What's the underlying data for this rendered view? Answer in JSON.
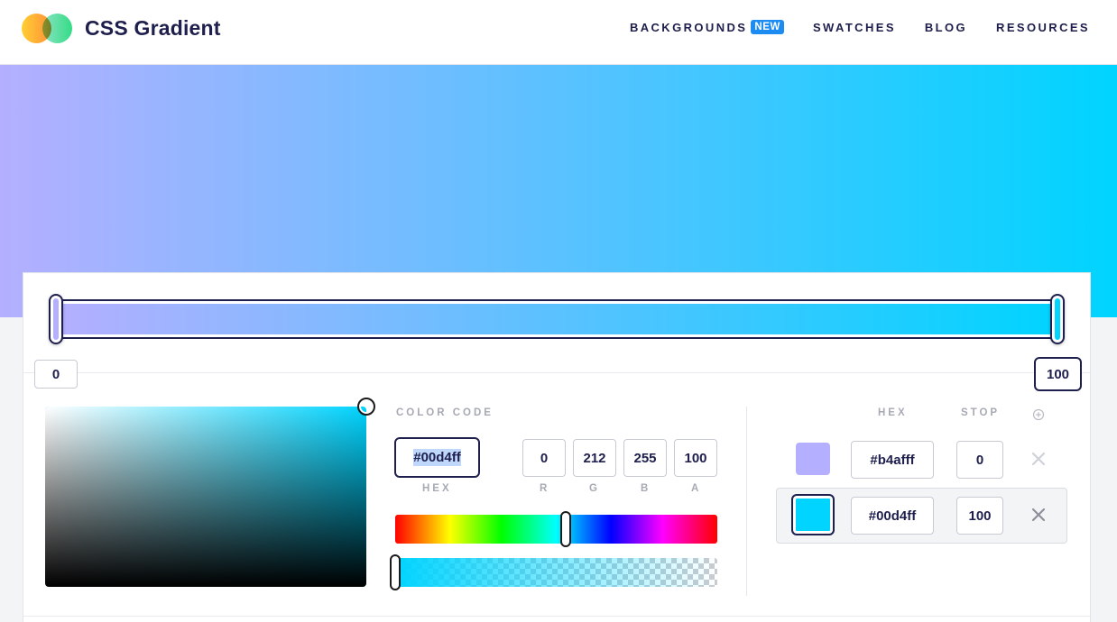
{
  "header": {
    "brand": "CSS Gradient",
    "nav": [
      {
        "label": "BACKGROUNDS",
        "badge": "NEW"
      },
      {
        "label": "SWATCHES"
      },
      {
        "label": "BLOG"
      },
      {
        "label": "RESOURCES"
      }
    ]
  },
  "gradient": {
    "start_color": "#b4afff",
    "end_color": "#00d4ff",
    "stops": [
      {
        "value": "0"
      },
      {
        "value": "100"
      }
    ]
  },
  "editor": {
    "color_code_label": "COLOR CODE",
    "hex_value": "#00d4ff",
    "hex_label": "HEX",
    "r": "0",
    "r_label": "R",
    "g": "212",
    "g_label": "G",
    "b": "255",
    "b_label": "B",
    "a": "100",
    "a_label": "A",
    "hue_fraction": 0.53,
    "alpha_fraction": 1.0
  },
  "stops_table": {
    "hex_header": "HEX",
    "stop_header": "STOP",
    "rows": [
      {
        "color": "#b4afff",
        "hex": "#b4afff",
        "stop": "0",
        "active": false
      },
      {
        "color": "#00d4ff",
        "hex": "#00d4ff",
        "stop": "100",
        "active": true
      }
    ]
  },
  "icons": {
    "add": "plus-circle-icon",
    "remove": "close-icon"
  }
}
